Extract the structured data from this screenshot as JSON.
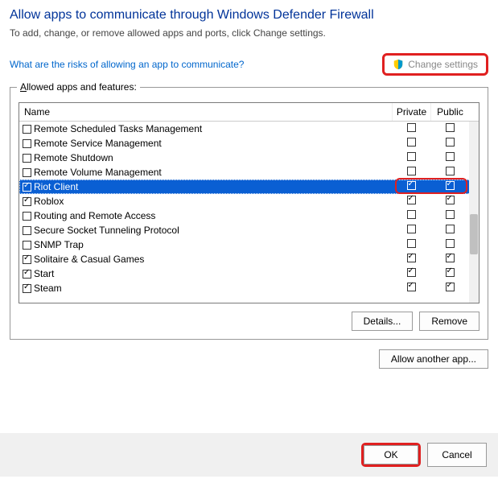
{
  "title": "Allow apps to communicate through Windows Defender Firewall",
  "subtitle": "To add, change, or remove allowed apps and ports, click Change settings.",
  "risks_link": "What are the risks of allowing an app to communicate?",
  "change_settings": "Change settings",
  "group_label": "Allowed apps and features:",
  "columns": {
    "name": "Name",
    "private": "Private",
    "public": "Public"
  },
  "rows": [
    {
      "name": "Remote Scheduled Tasks Management",
      "enabled": false,
      "private": false,
      "public": false,
      "selected": false
    },
    {
      "name": "Remote Service Management",
      "enabled": false,
      "private": false,
      "public": false,
      "selected": false
    },
    {
      "name": "Remote Shutdown",
      "enabled": false,
      "private": false,
      "public": false,
      "selected": false
    },
    {
      "name": "Remote Volume Management",
      "enabled": false,
      "private": false,
      "public": false,
      "selected": false
    },
    {
      "name": "Riot Client",
      "enabled": true,
      "private": true,
      "public": true,
      "selected": true
    },
    {
      "name": "Roblox",
      "enabled": true,
      "private": true,
      "public": true,
      "selected": false
    },
    {
      "name": "Routing and Remote Access",
      "enabled": false,
      "private": false,
      "public": false,
      "selected": false
    },
    {
      "name": "Secure Socket Tunneling Protocol",
      "enabled": false,
      "private": false,
      "public": false,
      "selected": false
    },
    {
      "name": "SNMP Trap",
      "enabled": false,
      "private": false,
      "public": false,
      "selected": false
    },
    {
      "name": "Solitaire & Casual Games",
      "enabled": true,
      "private": true,
      "public": true,
      "selected": false
    },
    {
      "name": "Start",
      "enabled": true,
      "private": true,
      "public": true,
      "selected": false
    },
    {
      "name": "Steam",
      "enabled": true,
      "private": true,
      "public": true,
      "selected": false
    }
  ],
  "details_btn": "Details...",
  "remove_btn": "Remove",
  "allow_btn": "Allow another app...",
  "ok_btn": "OK",
  "cancel_btn": "Cancel"
}
